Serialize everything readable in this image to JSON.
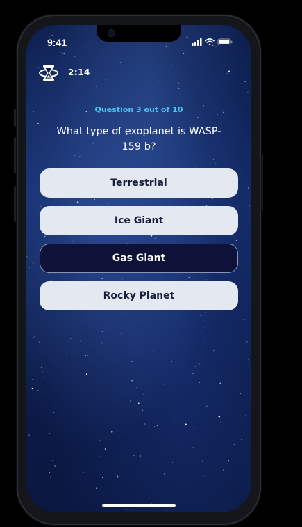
{
  "status_bar": {
    "time": "9:41",
    "icons": [
      "cellular-signal-icon",
      "wifi-icon",
      "battery-icon"
    ]
  },
  "timer": {
    "icon": "hourglass-icon",
    "value": "2:14"
  },
  "quiz": {
    "progress_label": "Question 3 out of 10",
    "current_question": 3,
    "total_questions": 10,
    "question_text": "What type of exoplanet is WASP-159 b?",
    "answers": [
      {
        "label": "Terrestrial",
        "selected": false
      },
      {
        "label": "Ice Giant",
        "selected": false
      },
      {
        "label": "Gas Giant",
        "selected": true
      },
      {
        "label": "Rocky Planet",
        "selected": false
      }
    ]
  },
  "colors": {
    "accent": "#4dc3f0",
    "answer_bg": "#e4e8f1",
    "answer_selected_bg": "#0e1238",
    "answer_text": "#17203e"
  }
}
